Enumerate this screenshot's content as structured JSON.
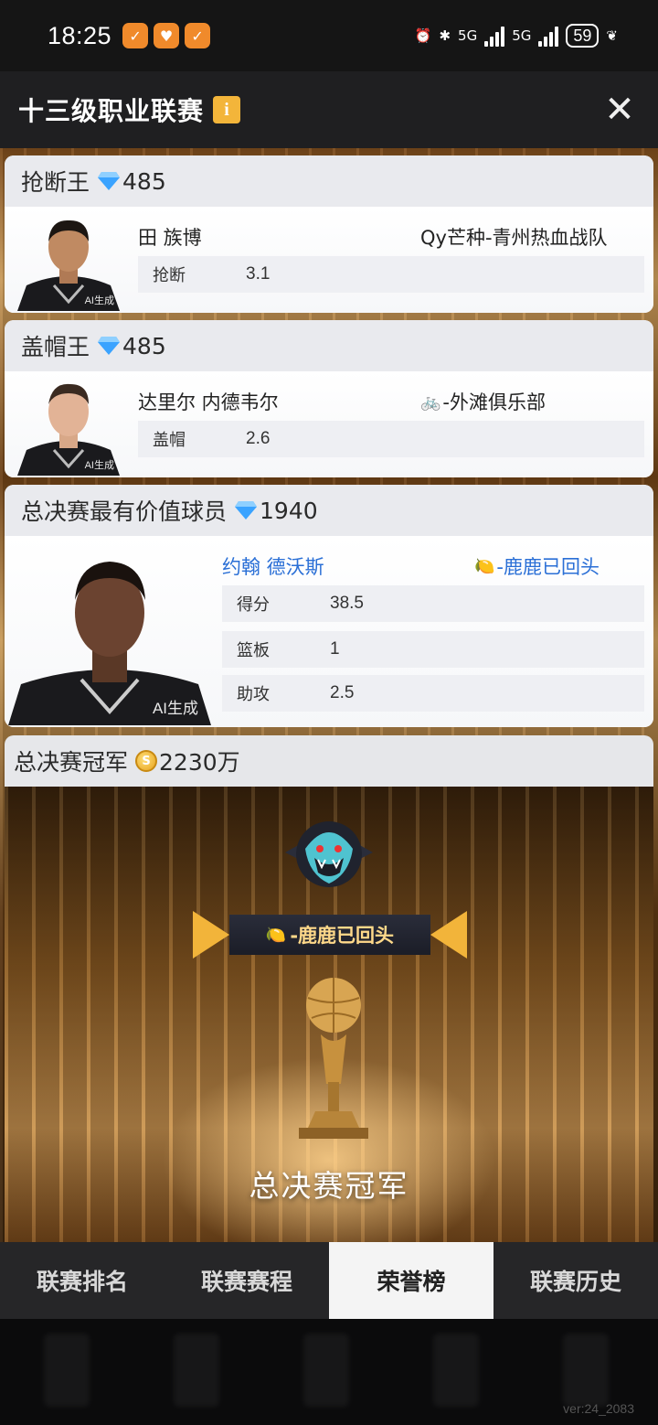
{
  "status_bar": {
    "time": "18:25",
    "battery": "59",
    "net1": "5G",
    "net2": "5G"
  },
  "header": {
    "title": "十三级职业联赛",
    "info": "i",
    "close": "✕"
  },
  "awards": [
    {
      "title": "抢断王",
      "reward": "485",
      "player": "田 族博",
      "team": "Qy芒种-青州热血战队",
      "stats": [
        {
          "label": "抢断",
          "value": "3.1"
        }
      ],
      "ai_tag": "AI生成"
    },
    {
      "title": "盖帽王",
      "reward": "485",
      "player": "达里尔 内德韦尔",
      "team": "-外滩俱乐部",
      "stats": [
        {
          "label": "盖帽",
          "value": "2.6"
        }
      ],
      "ai_tag": "AI生成"
    },
    {
      "title": "总决赛最有价值球员",
      "reward": "1940",
      "player": "约翰 德沃斯",
      "team": "-鹿鹿已回头",
      "stats": [
        {
          "label": "得分",
          "value": "38.5"
        },
        {
          "label": "篮板",
          "value": "1"
        },
        {
          "label": "助攻",
          "value": "2.5"
        }
      ],
      "ai_tag": "AI生成"
    }
  ],
  "champion": {
    "title": "总决赛冠军",
    "reward": "2230万",
    "team": "-鹿鹿已回头",
    "caption": "总决赛冠军"
  },
  "tabs": [
    {
      "label": "联赛排名",
      "active": false
    },
    {
      "label": "联赛赛程",
      "active": false
    },
    {
      "label": "荣誉榜",
      "active": true
    },
    {
      "label": "联赛历史",
      "active": false
    }
  ],
  "version": "ver:24_2083",
  "colors": {
    "accent_gold": "#f2b43a",
    "mvp_blue": "#2a6fd6",
    "gem_blue": "#3aa3ff"
  }
}
